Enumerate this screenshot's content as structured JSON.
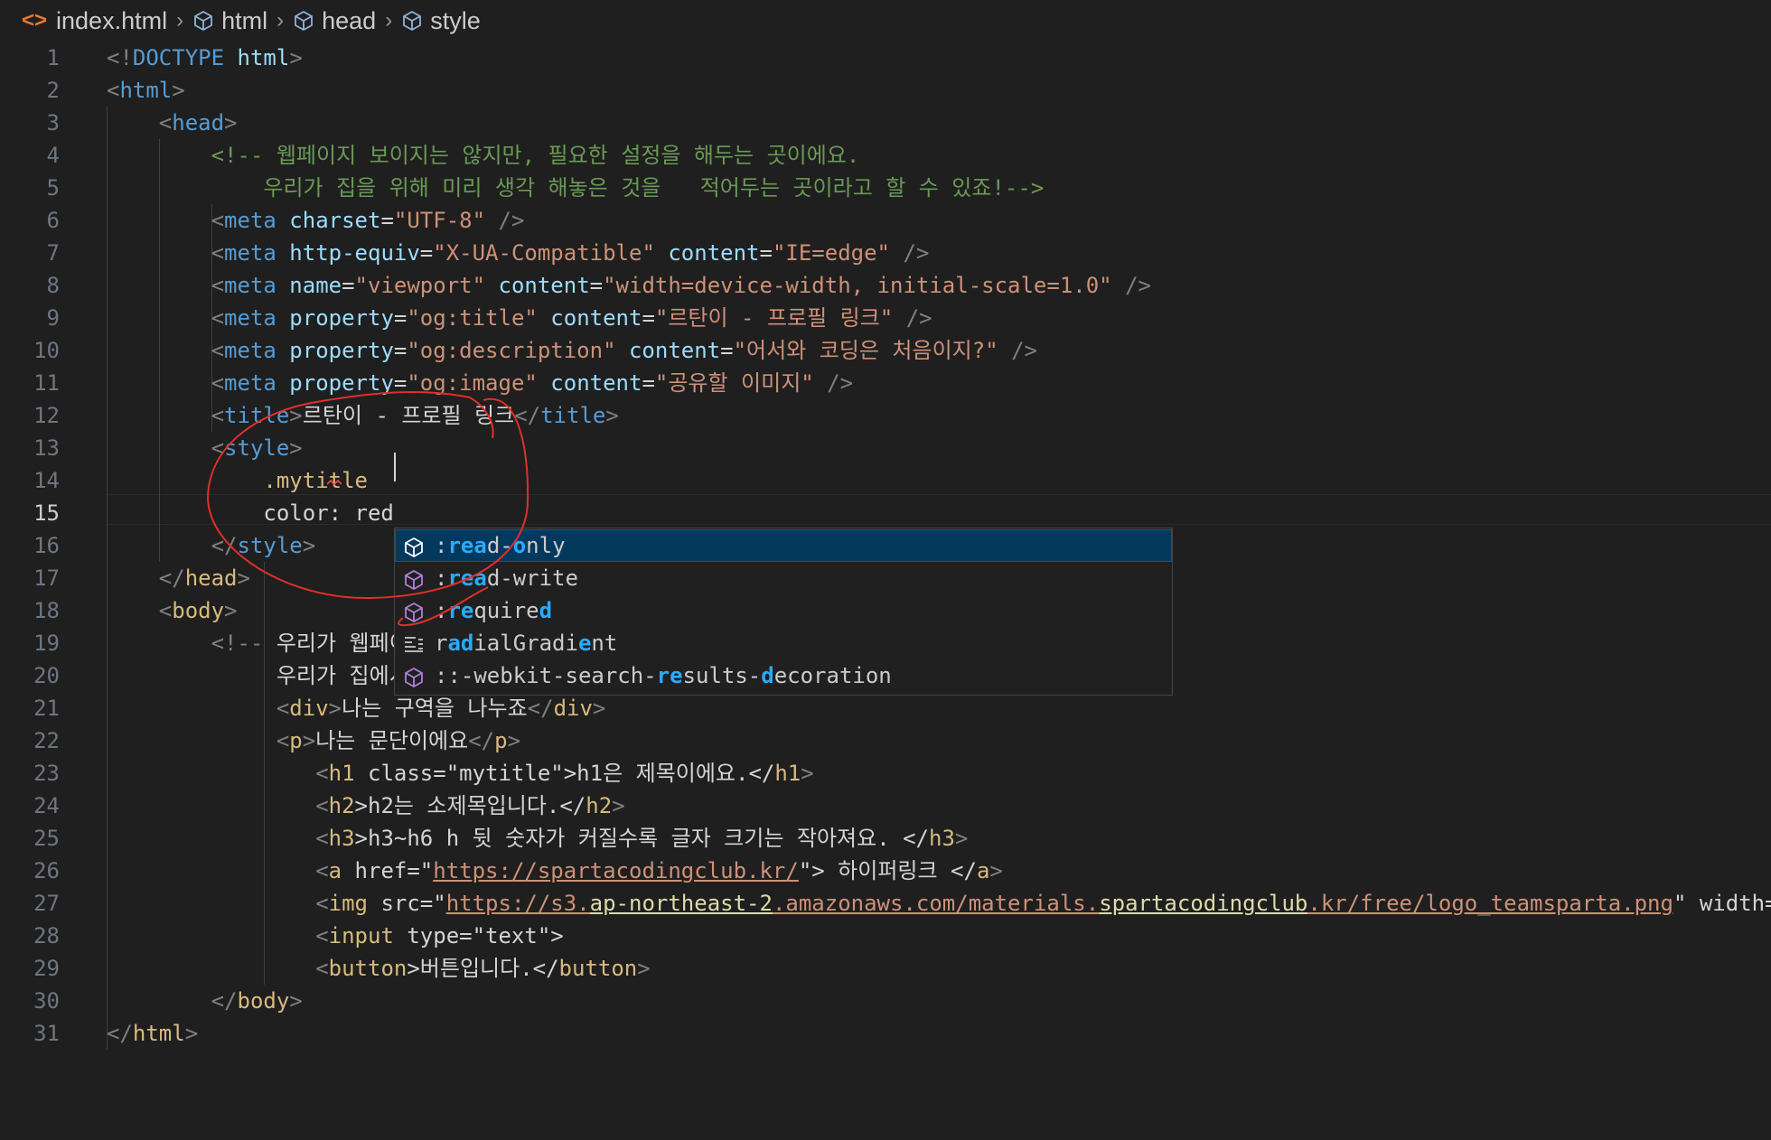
{
  "breadcrumb": {
    "file": "index.html",
    "path": [
      "html",
      "head",
      "style"
    ]
  },
  "colors": {
    "background": "#1f1f1f",
    "tag": "#569cd6",
    "attribute": "#9cdcfe",
    "string": "#ce9178",
    "comment": "#6a9955",
    "selector": "#d7ba7d",
    "suggest_selected": "#04395e",
    "annotation": "#e0302a"
  },
  "editor": {
    "current_line": 15,
    "lines": [
      {
        "n": "1",
        "tokens": [
          [
            "t-punct",
            "<!"
          ],
          [
            "t-tag",
            "DOCTYPE"
          ],
          [
            "t-text",
            " "
          ],
          [
            "t-attr",
            "html"
          ],
          [
            "t-punct",
            ">"
          ]
        ]
      },
      {
        "n": "2",
        "tokens": [
          [
            "t-punct",
            "<"
          ],
          [
            "t-tag",
            "html"
          ],
          [
            "t-punct",
            ">"
          ]
        ]
      },
      {
        "n": "3",
        "tokens": [
          [
            "t-text",
            "    "
          ],
          [
            "t-punct",
            "<"
          ],
          [
            "t-tag",
            "head"
          ],
          [
            "t-punct",
            ">"
          ]
        ]
      },
      {
        "n": "4",
        "tokens": [
          [
            "t-text",
            "        "
          ],
          [
            "t-comment",
            "<!-- 웹페이지 보이지는 않지만, 필요한 설정을 해두는 곳이에요."
          ]
        ]
      },
      {
        "n": "5",
        "tokens": [
          [
            "t-text",
            "            "
          ],
          [
            "t-comment",
            "우리가 집을 위해 미리 생각 해놓은 것을   적어두는 곳이라고 할 수 있죠!-->"
          ]
        ]
      },
      {
        "n": "6",
        "tokens": [
          [
            "t-text",
            "        "
          ],
          [
            "t-punct",
            "<"
          ],
          [
            "t-tag",
            "meta"
          ],
          [
            "t-text",
            " "
          ],
          [
            "t-attr",
            "charset"
          ],
          [
            "t-text",
            "="
          ],
          [
            "t-str",
            "\"UTF-8\""
          ],
          [
            "t-text",
            " "
          ],
          [
            "t-punct",
            "/>"
          ]
        ]
      },
      {
        "n": "7",
        "tokens": [
          [
            "t-text",
            "        "
          ],
          [
            "t-punct",
            "<"
          ],
          [
            "t-tag",
            "meta"
          ],
          [
            "t-text",
            " "
          ],
          [
            "t-attr",
            "http-equiv"
          ],
          [
            "t-text",
            "="
          ],
          [
            "t-str",
            "\"X-UA-Compatible\""
          ],
          [
            "t-text",
            " "
          ],
          [
            "t-attr",
            "content"
          ],
          [
            "t-text",
            "="
          ],
          [
            "t-str",
            "\"IE=edge\""
          ],
          [
            "t-text",
            " "
          ],
          [
            "t-punct",
            "/>"
          ]
        ]
      },
      {
        "n": "8",
        "tokens": [
          [
            "t-text",
            "        "
          ],
          [
            "t-punct",
            "<"
          ],
          [
            "t-tag",
            "meta"
          ],
          [
            "t-text",
            " "
          ],
          [
            "t-attr",
            "name"
          ],
          [
            "t-text",
            "="
          ],
          [
            "t-str",
            "\"viewport\""
          ],
          [
            "t-text",
            " "
          ],
          [
            "t-attr",
            "content"
          ],
          [
            "t-text",
            "="
          ],
          [
            "t-str",
            "\"width=device-width, initial-scale=1.0\""
          ],
          [
            "t-text",
            " "
          ],
          [
            "t-punct",
            "/>"
          ]
        ]
      },
      {
        "n": "9",
        "tokens": [
          [
            "t-text",
            "        "
          ],
          [
            "t-punct",
            "<"
          ],
          [
            "t-tag",
            "meta"
          ],
          [
            "t-text",
            " "
          ],
          [
            "t-attr",
            "property"
          ],
          [
            "t-text",
            "="
          ],
          [
            "t-str",
            "\"og:title\""
          ],
          [
            "t-text",
            " "
          ],
          [
            "t-attr",
            "content"
          ],
          [
            "t-text",
            "="
          ],
          [
            "t-str",
            "\"르탄이 - 프로필 링크\""
          ],
          [
            "t-text",
            " "
          ],
          [
            "t-punct",
            "/>"
          ]
        ]
      },
      {
        "n": "10",
        "tokens": [
          [
            "t-text",
            "        "
          ],
          [
            "t-punct",
            "<"
          ],
          [
            "t-tag",
            "meta"
          ],
          [
            "t-text",
            " "
          ],
          [
            "t-attr",
            "property"
          ],
          [
            "t-text",
            "="
          ],
          [
            "t-str",
            "\"og:description\""
          ],
          [
            "t-text",
            " "
          ],
          [
            "t-attr",
            "content"
          ],
          [
            "t-text",
            "="
          ],
          [
            "t-str",
            "\"어서와 코딩은 처음이지?\""
          ],
          [
            "t-text",
            " "
          ],
          [
            "t-punct",
            "/>"
          ]
        ]
      },
      {
        "n": "11",
        "tokens": [
          [
            "t-text",
            "        "
          ],
          [
            "t-punct",
            "<"
          ],
          [
            "t-tag",
            "meta"
          ],
          [
            "t-text",
            " "
          ],
          [
            "t-attr",
            "property"
          ],
          [
            "t-text",
            "="
          ],
          [
            "t-str",
            "\"og:image\""
          ],
          [
            "t-text",
            " "
          ],
          [
            "t-attr",
            "content"
          ],
          [
            "t-text",
            "="
          ],
          [
            "t-str",
            "\"공유할 이미지\""
          ],
          [
            "t-text",
            " "
          ],
          [
            "t-punct",
            "/>"
          ]
        ]
      },
      {
        "n": "12",
        "tokens": [
          [
            "t-text",
            "        "
          ],
          [
            "t-punct",
            "<"
          ],
          [
            "t-tag",
            "title"
          ],
          [
            "t-punct",
            ">"
          ],
          [
            "t-text",
            "르탄이 - 프로필 링크"
          ],
          [
            "t-punct",
            "</"
          ],
          [
            "t-tag",
            "title"
          ],
          [
            "t-punct",
            ">"
          ]
        ]
      },
      {
        "n": "13",
        "tokens": [
          [
            "t-text",
            "        "
          ],
          [
            "t-punct",
            "<"
          ],
          [
            "t-tag",
            "style"
          ],
          [
            "t-punct",
            ">"
          ]
        ]
      },
      {
        "n": "14",
        "tokens": [
          [
            "t-text",
            "            "
          ],
          [
            "t-sel",
            ".mytitle"
          ]
        ]
      },
      {
        "n": "15",
        "tokens": [
          [
            "t-text",
            "            "
          ],
          [
            "t-text",
            "color: red"
          ]
        ]
      },
      {
        "n": "16",
        "tokens": [
          [
            "t-text",
            "        "
          ],
          [
            "t-punct",
            "</"
          ],
          [
            "t-tag",
            "style"
          ],
          [
            "t-punct",
            ">"
          ]
        ]
      },
      {
        "n": "17",
        "tokens": [
          [
            "t-text",
            "    "
          ],
          [
            "t-punct",
            "</"
          ],
          [
            "t-tag-amber",
            "head"
          ],
          [
            "t-punct",
            ">"
          ]
        ]
      },
      {
        "n": "18",
        "tokens": [
          [
            "t-text",
            "    "
          ],
          [
            "t-punct",
            "<"
          ],
          [
            "t-tag-amber",
            "body"
          ],
          [
            "t-punct",
            ">"
          ]
        ]
      },
      {
        "n": "19",
        "tokens": [
          [
            "t-text",
            "        "
          ],
          [
            "t-punct",
            "<!-- "
          ],
          [
            "t-text",
            "우리가 웹페이지 보여줄 것들"
          ]
        ]
      },
      {
        "n": "20",
        "tokens": [
          [
            "t-text",
            "             "
          ],
          [
            "t-text",
            "우리가 집에서 볼 수 있는 것들"
          ]
        ]
      },
      {
        "n": "21",
        "tokens": [
          [
            "t-text",
            "             "
          ],
          [
            "t-punct",
            "<"
          ],
          [
            "t-tag-amber",
            "div"
          ],
          [
            "t-punct",
            ">"
          ],
          [
            "t-text",
            "나는 구역을 나누죠"
          ],
          [
            "t-punct",
            "</"
          ],
          [
            "t-tag-amber",
            "div"
          ],
          [
            "t-punct",
            ">"
          ]
        ]
      },
      {
        "n": "22",
        "tokens": [
          [
            "t-text",
            "             "
          ],
          [
            "t-punct",
            "<"
          ],
          [
            "t-tag-amber",
            "p"
          ],
          [
            "t-punct",
            ">"
          ],
          [
            "t-text",
            "나는 문단이에요"
          ],
          [
            "t-punct",
            "</"
          ],
          [
            "t-tag-amber",
            "p"
          ],
          [
            "t-punct",
            ">"
          ]
        ]
      },
      {
        "n": "23",
        "tokens": [
          [
            "t-text",
            "                "
          ],
          [
            "t-punct",
            "<"
          ],
          [
            "t-tag-amber",
            "h1"
          ],
          [
            "t-text",
            " class=\"mytitle\">h1은 제목이에요.</"
          ],
          [
            "t-tag-amber",
            "h1"
          ],
          [
            "t-punct",
            ">"
          ]
        ]
      },
      {
        "n": "24",
        "tokens": [
          [
            "t-text",
            "                "
          ],
          [
            "t-punct",
            "<"
          ],
          [
            "t-tag-amber",
            "h2"
          ],
          [
            "t-text",
            ">h2는 소제목입니다.</"
          ],
          [
            "t-tag-amber",
            "h2"
          ],
          [
            "t-punct",
            ">"
          ]
        ]
      },
      {
        "n": "25",
        "tokens": [
          [
            "t-text",
            "                "
          ],
          [
            "t-punct",
            "<"
          ],
          [
            "t-tag-amber",
            "h3"
          ],
          [
            "t-text",
            ">h3~h6 h 뒷 숫자가 커질수록 글자 크기는 작아져요. </"
          ],
          [
            "t-tag-amber",
            "h3"
          ],
          [
            "t-punct",
            ">"
          ]
        ]
      },
      {
        "n": "26",
        "tokens": [
          [
            "t-text",
            "                "
          ],
          [
            "t-punct",
            "<"
          ],
          [
            "t-tag-amber",
            "a"
          ],
          [
            "t-text",
            " href=\""
          ],
          [
            "t-link",
            "https://spartacodingclub.kr/"
          ],
          [
            "t-text",
            "\"> 하이퍼링크 </"
          ],
          [
            "t-tag-amber",
            "a"
          ],
          [
            "t-punct",
            ">"
          ]
        ]
      },
      {
        "n": "27",
        "tokens": [
          [
            "t-text",
            "                "
          ],
          [
            "t-punct",
            "<"
          ],
          [
            "t-tag-amber",
            "img"
          ],
          [
            "t-text",
            " src=\""
          ],
          [
            "t-link",
            "https://s3."
          ],
          [
            "t-link-hl",
            "ap-northeast-2"
          ],
          [
            "t-link",
            ".amazonaws.com/materials."
          ],
          [
            "t-link-hl",
            "spartacodingclub"
          ],
          [
            "t-link",
            ".kr/free/logo_teamsparta.png"
          ],
          [
            "t-text",
            "\" width="
          ]
        ]
      },
      {
        "n": "28",
        "tokens": [
          [
            "t-text",
            "                "
          ],
          [
            "t-punct",
            "<"
          ],
          [
            "t-tag-amber",
            "input"
          ],
          [
            "t-text",
            " type=\"text\">"
          ]
        ]
      },
      {
        "n": "29",
        "tokens": [
          [
            "t-text",
            "                "
          ],
          [
            "t-punct",
            "<"
          ],
          [
            "t-tag-amber",
            "button"
          ],
          [
            "t-text",
            ">버튼입니다.</"
          ],
          [
            "t-tag-amber",
            "button"
          ],
          [
            "t-punct",
            ">"
          ]
        ]
      },
      {
        "n": "30",
        "tokens": [
          [
            "t-text",
            "        "
          ],
          [
            "t-punct",
            "</"
          ],
          [
            "t-tag-amber",
            "body"
          ],
          [
            "t-punct",
            ">"
          ]
        ]
      },
      {
        "n": "31",
        "tokens": [
          [
            "t-punct",
            "</"
          ],
          [
            "t-tag-amber",
            "html"
          ],
          [
            "t-punct",
            ">"
          ]
        ]
      }
    ]
  },
  "suggest": {
    "items": [
      {
        "icon": "css-selector-cube-icon",
        "selected": true,
        "parts": [
          [
            ":",
            0
          ],
          [
            "rea",
            1
          ],
          [
            "d-",
            0
          ],
          [
            "o",
            1
          ],
          [
            "nly",
            0
          ]
        ]
      },
      {
        "icon": "css-selector-cube-icon",
        "selected": false,
        "parts": [
          [
            ":",
            0
          ],
          [
            "rea",
            1
          ],
          [
            "d-write",
            0
          ]
        ]
      },
      {
        "icon": "css-selector-cube-icon",
        "selected": false,
        "parts": [
          [
            ":",
            0
          ],
          [
            "re",
            1
          ],
          [
            "quire",
            0
          ],
          [
            "d",
            1
          ]
        ]
      },
      {
        "icon": "snippet-text-icon",
        "selected": false,
        "parts": [
          [
            "r",
            0
          ],
          [
            "ad",
            1
          ],
          [
            "ialGradi",
            0
          ],
          [
            "e",
            1
          ],
          [
            "nt",
            0
          ]
        ]
      },
      {
        "icon": "css-selector-cube-icon",
        "selected": false,
        "parts": [
          [
            "::-webkit-search-",
            0
          ],
          [
            "re",
            1
          ],
          [
            "sults-",
            0
          ],
          [
            "d",
            1
          ],
          [
            "ecoration",
            0
          ]
        ]
      }
    ]
  }
}
